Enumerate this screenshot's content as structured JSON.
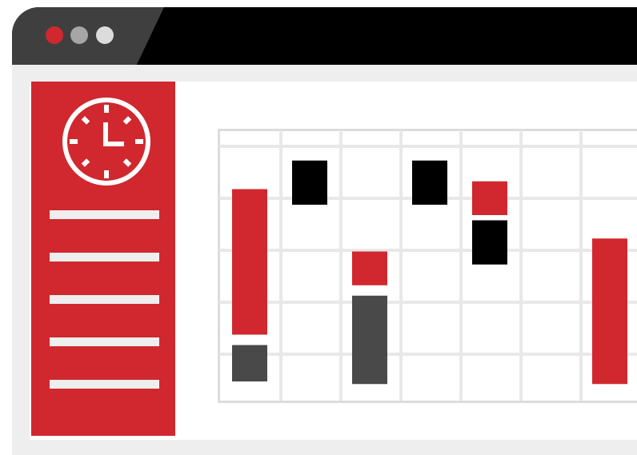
{
  "window": {
    "controls": [
      {
        "name": "close",
        "color": "#d0282e"
      },
      {
        "name": "minimize",
        "color": "#a6a6a6"
      },
      {
        "name": "maximize",
        "color": "#dcdcdc"
      }
    ]
  },
  "theme": {
    "accent": "#d0282e",
    "dark": "#000000",
    "dark_gray": "#4a494a",
    "light_gray": "#eeeeee",
    "grid_line": "#e8e8e8",
    "background": "#ffffff"
  },
  "sidebar": {
    "icon": "clock-icon",
    "menu_item_count": 5
  },
  "calendar": {
    "columns": 7,
    "rows": 5,
    "events": [
      {
        "column": 0,
        "row_start": 1.1,
        "row_end": 3.9,
        "color": "#d0282e"
      },
      {
        "column": 0,
        "row_start": 4.1,
        "row_end": 4.8,
        "color": "#4a494a"
      },
      {
        "column": 1,
        "row_start": 0.55,
        "row_end": 1.4,
        "color": "#000000"
      },
      {
        "column": 2,
        "row_start": 2.3,
        "row_end": 2.95,
        "color": "#d0282e"
      },
      {
        "column": 2,
        "row_start": 3.15,
        "row_end": 4.85,
        "color": "#4a494a"
      },
      {
        "column": 3,
        "row_start": 0.55,
        "row_end": 1.4,
        "color": "#000000"
      },
      {
        "column": 4,
        "row_start": 0.95,
        "row_end": 1.6,
        "color": "#d0282e"
      },
      {
        "column": 4,
        "row_start": 1.7,
        "row_end": 2.55,
        "color": "#000000"
      },
      {
        "column": 6,
        "row_start": 2.05,
        "row_end": 4.85,
        "color": "#d0282e"
      }
    ]
  }
}
